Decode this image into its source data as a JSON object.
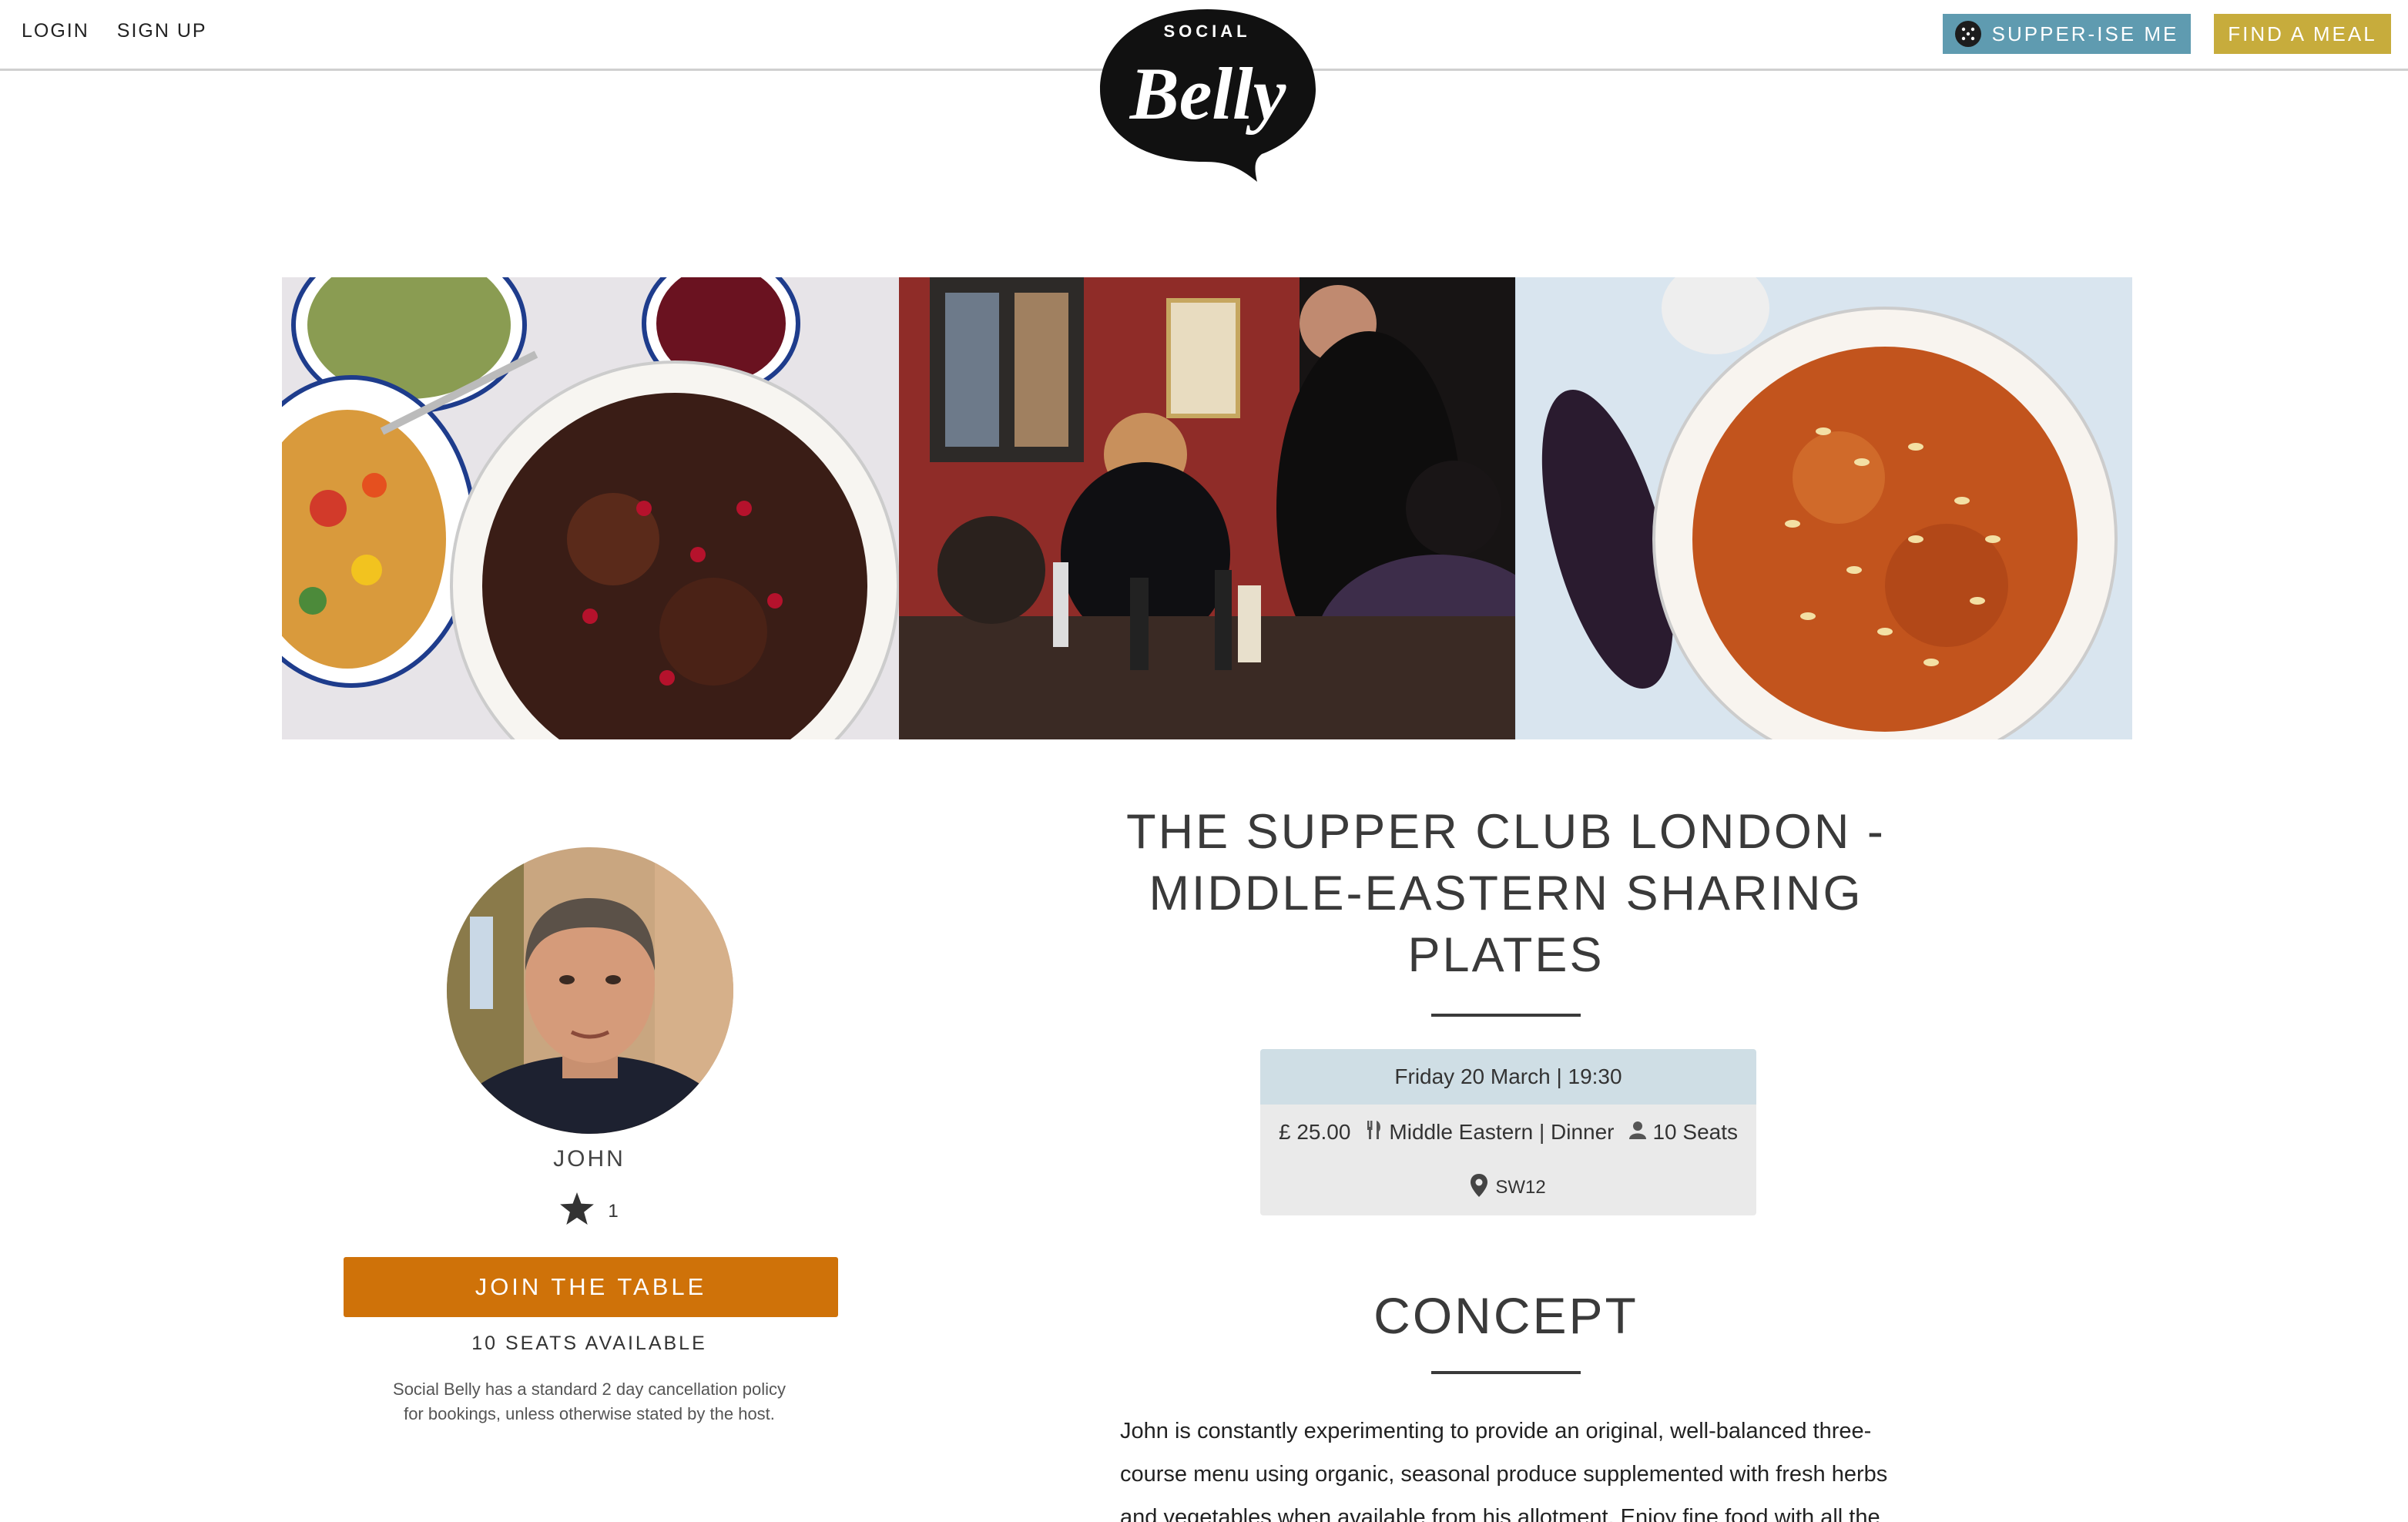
{
  "header": {
    "login_label": "LOGIN",
    "signup_label": "SIGN UP",
    "supper_label": "SUPPER-ISE ME",
    "find_label": "FIND A MEAL",
    "logo_top": "SOCIAL",
    "logo_main": "Belly"
  },
  "host": {
    "name": "JOHN",
    "rating": "1",
    "join_label": "JOIN THE TABLE",
    "seats_available": "10 SEATS AVAILABLE",
    "policy_line1": "Social Belly has a standard 2 day cancellation policy",
    "policy_line2": "for bookings, unless otherwise stated by the host."
  },
  "event": {
    "title": "THE SUPPER CLUB LONDON - MIDDLE-EASTERN SHARING PLATES",
    "datetime": "Friday 20 March | 19:30",
    "price": "£ 25.00",
    "cuisine": "Middle Eastern | Dinner",
    "seats": "10 Seats",
    "location": "SW12"
  },
  "concept": {
    "heading": "CONCEPT",
    "text": "John is constantly experimenting to provide an original, well-balanced three-course menu using organic, seasonal produce supplemented with fresh herbs and vegetables when available from his allotment. Enjoy fine food with all the"
  },
  "colors": {
    "supper_button": "#5f9bb0",
    "find_button": "#c7ac3c",
    "join_button": "#cf7209",
    "info_date_bg": "#cfdee5",
    "info_bg": "#eaeaea"
  },
  "icons": [
    "dice-icon",
    "star-icon",
    "cutlery-icon",
    "person-icon",
    "map-pin-icon"
  ]
}
